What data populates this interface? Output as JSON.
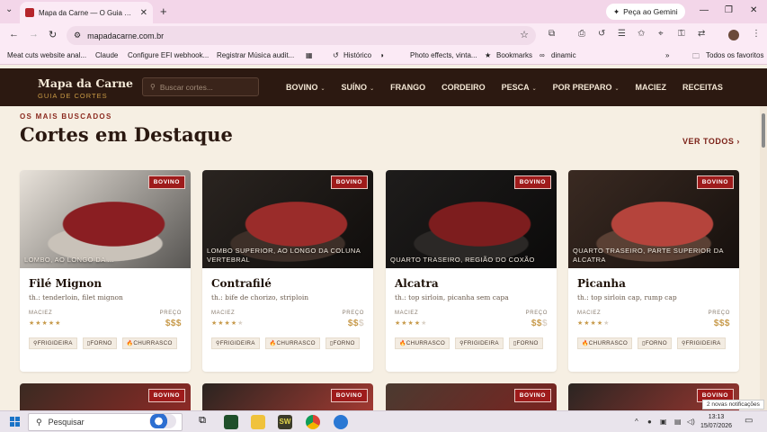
{
  "browser": {
    "tab_title": "Mapa da Carne — O Guia Definitivo",
    "gemini_label": "Peça ao Gemini",
    "url": "mapadacarne.com.br",
    "bookmarks": [
      "Meat cuts website anal...",
      "Claude",
      "Configure EFI webhook...",
      "Registrar Música audit...",
      "Histórico",
      "Photo effects, vinta...",
      "Bookmarks",
      "dinamic"
    ],
    "all_favorites": "Todos os favoritos"
  },
  "site": {
    "logo_title": "Mapa da Carne",
    "logo_sub": "GUIA DE CORTES",
    "search_placeholder": "Buscar cortes...",
    "menu": [
      {
        "label": "BOVINO",
        "caret": "⌄"
      },
      {
        "label": "SUÍNO",
        "caret": "⌄"
      },
      {
        "label": "FRANGO",
        "caret": ""
      },
      {
        "label": "CORDEIRO",
        "caret": ""
      },
      {
        "label": "PESCA",
        "caret": "⌄"
      },
      {
        "label": "POR PREPARO",
        "caret": "⌄"
      },
      {
        "label": "MACIEZ",
        "caret": ""
      },
      {
        "label": "RECEITAS",
        "caret": ""
      }
    ]
  },
  "section": {
    "eyebrow": "OS MAIS BUSCADOS",
    "title": "Cortes em Destaque",
    "see_all": "VER TODOS  ›"
  },
  "labels": {
    "maciez": "MACIEZ",
    "preco": "PREÇO"
  },
  "cards": [
    {
      "badge": "BOVINO",
      "caption": "LOMBO, AO LONGO DA ...",
      "title": "Filé Mignon",
      "aka": "th.: tenderloin, filet mignon",
      "stars_on": "★★★★★",
      "stars_off": "",
      "price_on": "$$$",
      "price_off": "",
      "tags": [
        "FRIGIDEIRA",
        "FORNO",
        "CHURRASCO"
      ],
      "colors": [
        "#e8e2da",
        "#8a1e22",
        "#c9c2b9"
      ]
    },
    {
      "badge": "BOVINO",
      "caption": "LOMBO SUPERIOR, AO LONGO DA COLUNA VERTEBRAL",
      "title": "Contrafilé",
      "aka": "th.: bife de chorizo, striploin",
      "stars_on": "★★★★",
      "stars_off": "★",
      "price_on": "$$",
      "price_off": "$",
      "tags": [
        "FRIGIDEIRA",
        "CHURRASCO",
        "FORNO"
      ],
      "colors": [
        "#2a2420",
        "#9a2c2a",
        "#3d2f28"
      ]
    },
    {
      "badge": "BOVINO",
      "caption": "QUARTO TRASEIRO, REGIÃO DO COXÃO",
      "title": "Alcatra",
      "aka": "th.: top sirloin, picanha sem capa",
      "stars_on": "★★★★",
      "stars_off": "★",
      "price_on": "$$",
      "price_off": "$",
      "tags": [
        "CHURRASCO",
        "FRIGIDEIRA",
        "FORNO"
      ],
      "colors": [
        "#1e1c1b",
        "#7d1d1e",
        "#2b2826"
      ]
    },
    {
      "badge": "BOVINO",
      "caption": "QUARTO TRASEIRO, PARTE SUPERIOR DA ALCATRA",
      "title": "Picanha",
      "aka": "th.: top sirloin cap, rump cap",
      "stars_on": "★★★★",
      "stars_off": "★",
      "price_on": "$$$",
      "price_off": "",
      "tags": [
        "CHURRASCO",
        "FORNO",
        "FRIGIDEIRA"
      ],
      "colors": [
        "#3a2a22",
        "#b5443c",
        "#5a4034"
      ]
    }
  ],
  "taskbar": {
    "search_label": "Pesquisar",
    "time": "13:13",
    "date": "15/07/2026",
    "notifications": "2 novas notificações"
  }
}
